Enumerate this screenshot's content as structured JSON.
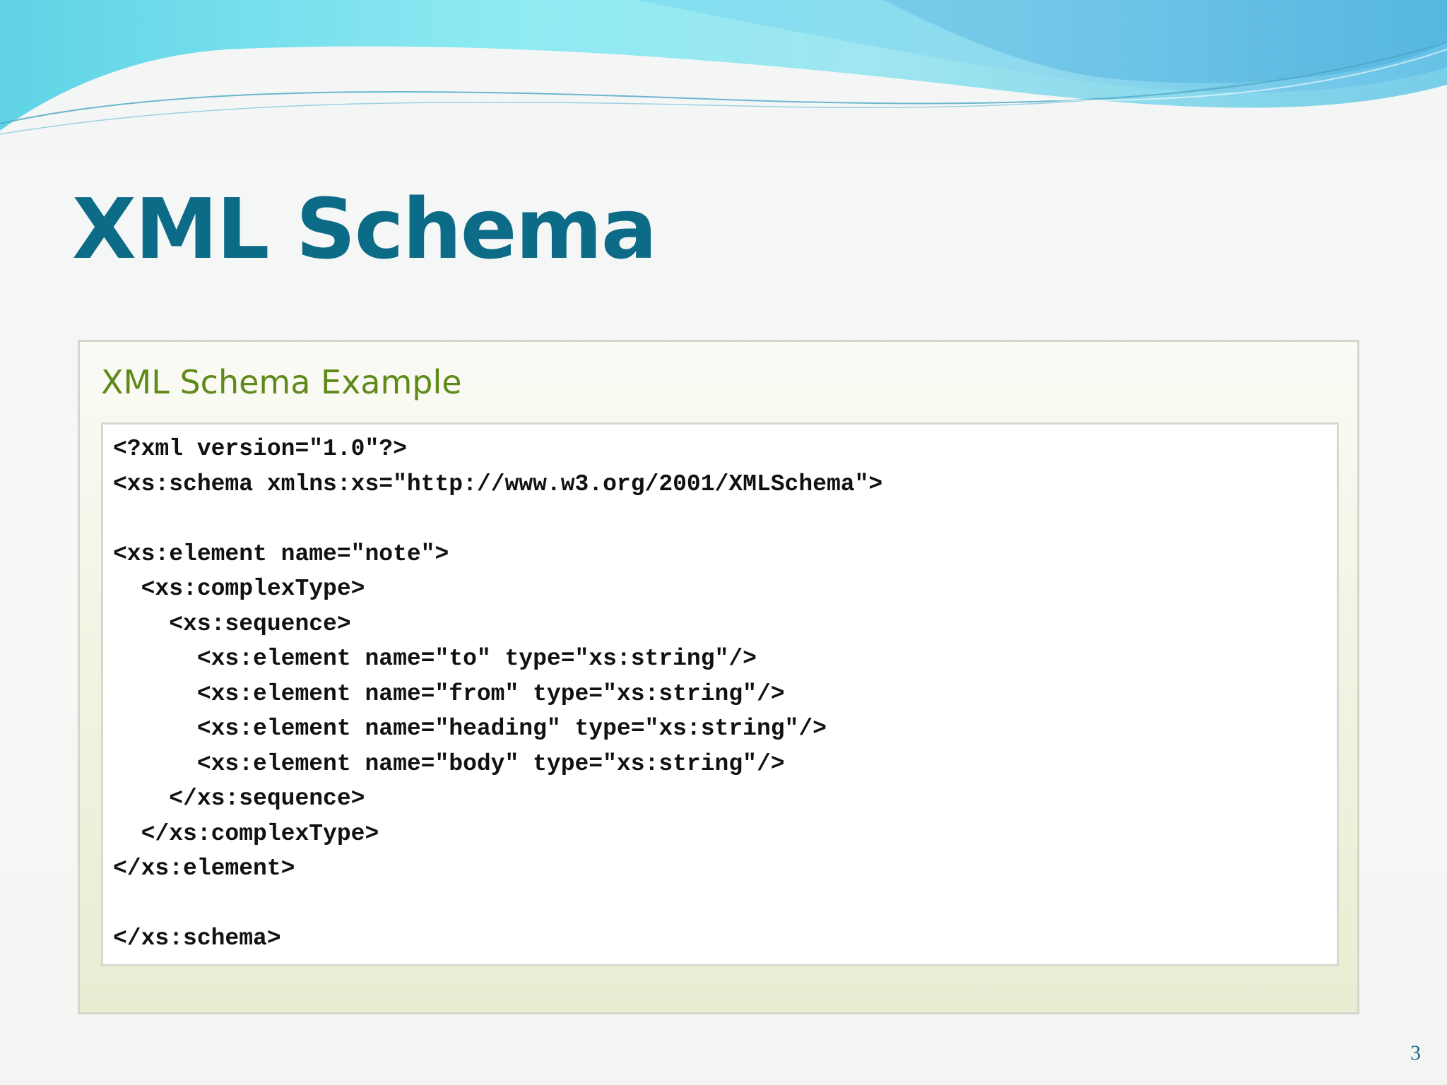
{
  "slide": {
    "title": "XML Schema",
    "page_number": "3"
  },
  "example": {
    "heading": "XML Schema Example",
    "code_lines": [
      "<?xml version=\"1.0\"?>",
      "<xs:schema xmlns:xs=\"http://www.w3.org/2001/XMLSchema\">",
      "",
      "<xs:element name=\"note\">",
      "  <xs:complexType>",
      "    <xs:sequence>",
      "      <xs:element name=\"to\" type=\"xs:string\"/>",
      "      <xs:element name=\"from\" type=\"xs:string\"/>",
      "      <xs:element name=\"heading\" type=\"xs:string\"/>",
      "      <xs:element name=\"body\" type=\"xs:string\"/>",
      "    </xs:sequence>",
      "  </xs:complexType>",
      "</xs:element>",
      "",
      "</xs:schema>"
    ]
  },
  "colors": {
    "title": "#0c6b86",
    "example_heading": "#5f8a1a",
    "wave_light": "#8eeaf2",
    "wave_dark": "#5cb8e0"
  }
}
